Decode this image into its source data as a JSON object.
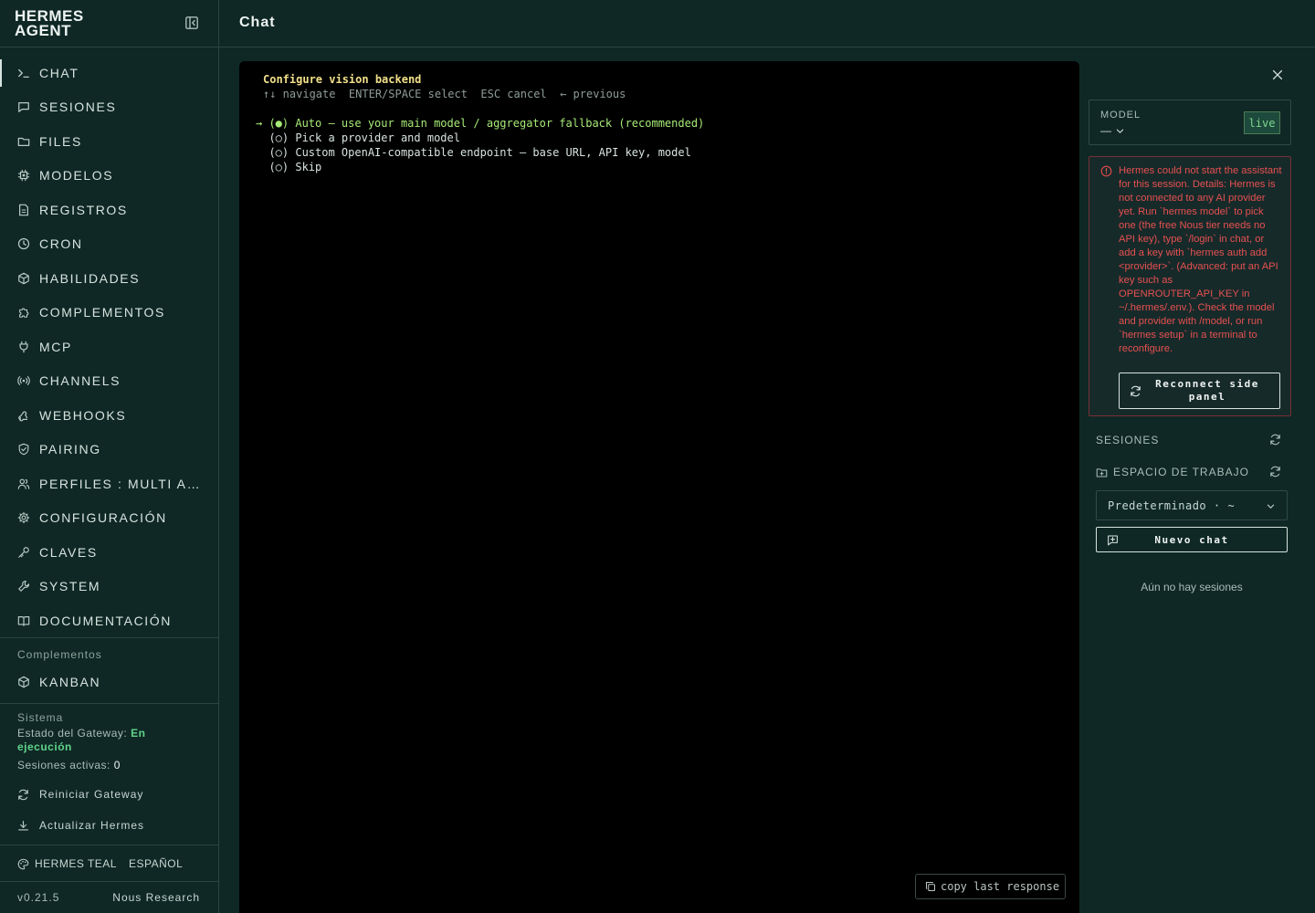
{
  "brand": {
    "line1": "HERMES",
    "line2": "AGENT"
  },
  "header": {
    "title": "Chat"
  },
  "nav": [
    {
      "id": "chat",
      "label": "CHAT",
      "icon": "terminal-icon",
      "active": true
    },
    {
      "id": "sesiones",
      "label": "SESIONES",
      "icon": "message-icon"
    },
    {
      "id": "files",
      "label": "FILES",
      "icon": "folder-icon"
    },
    {
      "id": "modelos",
      "label": "MODELOS",
      "icon": "cpu-icon"
    },
    {
      "id": "registros",
      "label": "REGISTROS",
      "icon": "file-text-icon"
    },
    {
      "id": "cron",
      "label": "CRON",
      "icon": "clock-icon"
    },
    {
      "id": "habilidades",
      "label": "HABILIDADES",
      "icon": "package-icon"
    },
    {
      "id": "complementos",
      "label": "COMPLEMENTOS",
      "icon": "puzzle-icon"
    },
    {
      "id": "mcp",
      "label": "MCP",
      "icon": "plug-icon"
    },
    {
      "id": "channels",
      "label": "CHANNELS",
      "icon": "radio-icon"
    },
    {
      "id": "webhooks",
      "label": "WEBHOOKS",
      "icon": "webhook-icon"
    },
    {
      "id": "pairing",
      "label": "PAIRING",
      "icon": "shield-check-icon"
    },
    {
      "id": "perfiles",
      "label": "PERFILES : MULTI AG…",
      "icon": "users-icon"
    },
    {
      "id": "configuracion",
      "label": "CONFIGURACIÓN",
      "icon": "settings-icon"
    },
    {
      "id": "claves",
      "label": "CLAVES",
      "icon": "key-icon"
    },
    {
      "id": "system",
      "label": "SYSTEM",
      "icon": "wrench-icon"
    },
    {
      "id": "documentacion",
      "label": "DOCUMENTACIÓN",
      "icon": "book-icon"
    }
  ],
  "plugins": {
    "section_label": "Complementos",
    "items": [
      {
        "id": "kanban",
        "label": "KANBAN",
        "icon": "package-icon"
      }
    ]
  },
  "system": {
    "section_label": "Sistema",
    "gateway_label": "Estado del Gateway:",
    "gateway_status_1": "En",
    "gateway_status_2": "ejecución",
    "active_sessions_label": "Sesiones activas:",
    "active_sessions_value": "0",
    "restart_label": "Reiniciar Gateway",
    "update_label": "Actualizar Hermes"
  },
  "footer": {
    "theme_label": "HERMES TEAL",
    "language_label": "ESPAÑOL",
    "version": "v0.21.5",
    "vendor": "Nous Research"
  },
  "terminal": {
    "title": "Configure vision backend",
    "hint": "↑↓ navigate  ENTER/SPACE select  ESC cancel  ← previous",
    "options": [
      {
        "text": "→ (●) Auto — use your main model / aggregator fallback (recommended)",
        "selected": true
      },
      {
        "text": "  (○) Pick a provider and model",
        "selected": false
      },
      {
        "text": "  (○) Custom OpenAI-compatible endpoint — base URL, API key, model",
        "selected": false
      },
      {
        "text": "  (○) Skip",
        "selected": false
      }
    ],
    "copy_label": "copy last response"
  },
  "right_panel": {
    "model_label": "MODEL",
    "model_value": "—",
    "live_badge": "live",
    "error_text": "Hermes could not start the assistant for this session. Details: Hermes is not connected to any AI provider yet. Run `hermes model` to pick one (the free Nous tier needs no API key), type `/login` in chat, or add a key with `hermes auth add <provider>`. (Advanced: put an API key such as OPENROUTER_API_KEY in ~/.hermes/.env.). Check the model and provider with /model, or run `hermes setup` in a terminal to reconfigure.",
    "reconnect_label": "Reconnect side panel",
    "sessions_label": "SESIONES",
    "workspace_label": "ESPACIO DE TRABAJO",
    "workspace_value": "Predeterminado · ~",
    "new_chat_label": "Nuevo chat",
    "empty_sessions": "Aún no hay sesiones"
  },
  "colors": {
    "background": "#0f2825",
    "terminal_bg": "#000000",
    "accent_green": "#a7ea76",
    "title_yellow": "#f1e08a",
    "error_red": "#e65050",
    "status_green": "#5fd38a"
  }
}
